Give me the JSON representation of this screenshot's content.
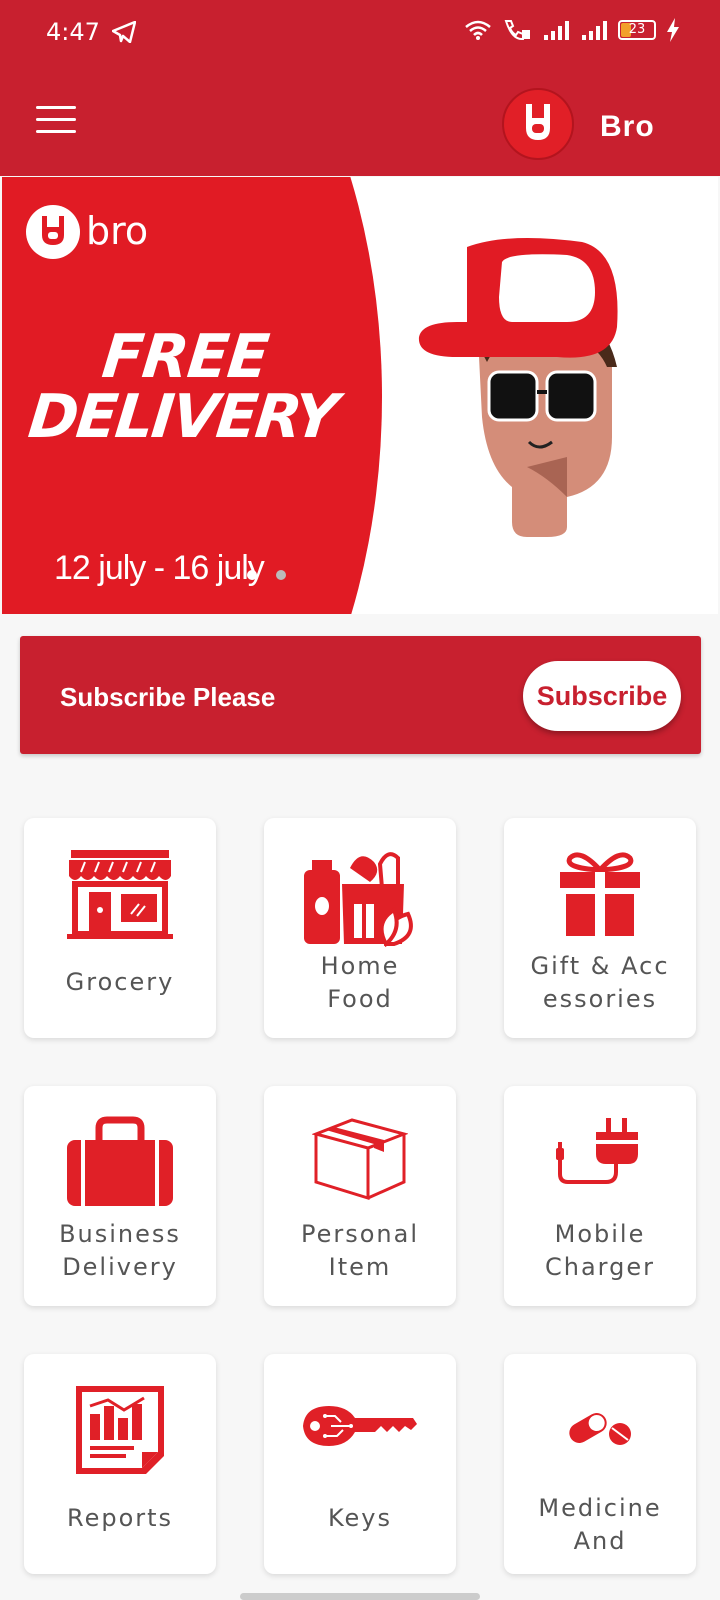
{
  "status_bar": {
    "time": "4:47",
    "battery_level": "23",
    "icons": [
      "telegram-icon",
      "wifi-icon",
      "wifi-calling-icon",
      "signal-icon",
      "signal-icon",
      "battery-icon",
      "charging-icon"
    ]
  },
  "app_bar": {
    "menu_icon": "hamburger-menu-icon",
    "title": "Bro"
  },
  "banner": {
    "brand": "bro",
    "headline_line1": "FREE",
    "headline_line2": "DELIVERY",
    "dates": "12 july - 16 july",
    "carousel_index": 1,
    "carousel_count": 2
  },
  "subscribe": {
    "text": "Subscribe Please",
    "button_label": "Subscribe"
  },
  "categories": [
    {
      "label": "Grocery",
      "icon": "storefront-icon"
    },
    {
      "label": "Home\nFood",
      "icon": "grocery-bag-icon"
    },
    {
      "label": "Gift & Acc\nessories",
      "icon": "gift-icon"
    },
    {
      "label": "Business\nDelivery",
      "icon": "briefcase-icon"
    },
    {
      "label": "Personal\nItem",
      "icon": "box-icon"
    },
    {
      "label": "Mobile\nCharger",
      "icon": "charger-icon"
    },
    {
      "label": "Reports",
      "icon": "report-icon"
    },
    {
      "label": "Keys",
      "icon": "key-icon"
    },
    {
      "label": "Medicine\nAnd",
      "icon": "pill-icon"
    }
  ],
  "colors": {
    "primary": "#c8202f",
    "banner_red": "#e11b24",
    "icon_red": "#e02027"
  }
}
